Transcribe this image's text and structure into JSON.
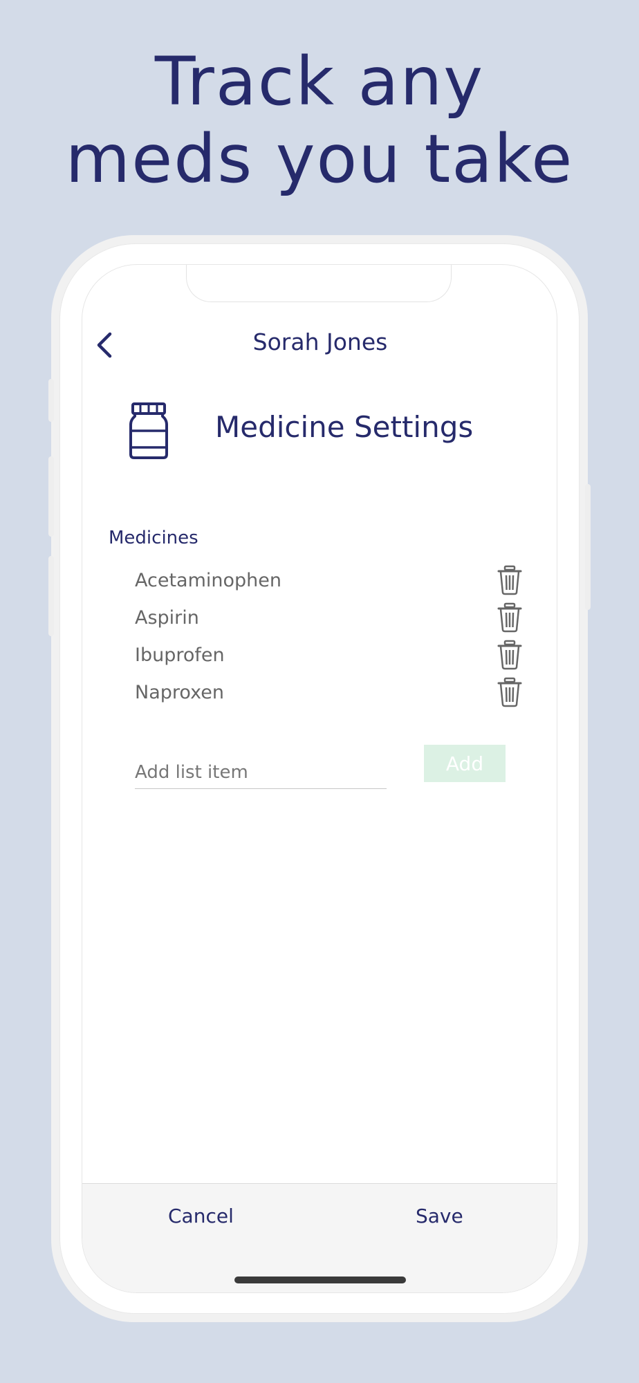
{
  "headline": {
    "line1": "Track any",
    "line2": "meds you take"
  },
  "nav": {
    "title": "Sorah Jones",
    "back_icon": "chevron-left-icon"
  },
  "settings": {
    "title": "Medicine Settings",
    "icon": "medicine-bottle-icon"
  },
  "medicines": {
    "label": "Medicines",
    "items": [
      {
        "name": "Acetaminophen"
      },
      {
        "name": "Aspirin"
      },
      {
        "name": "Ibuprofen"
      },
      {
        "name": "Naproxen"
      }
    ],
    "delete_icon": "trash-icon"
  },
  "add_item": {
    "placeholder": "Add list item",
    "button_label": "Add"
  },
  "footer": {
    "cancel_label": "Cancel",
    "save_label": "Save"
  },
  "colors": {
    "background": "#d3dbe8",
    "primary_text": "#262a6b",
    "secondary_text": "#666666",
    "add_button": "#dcf1e4"
  }
}
